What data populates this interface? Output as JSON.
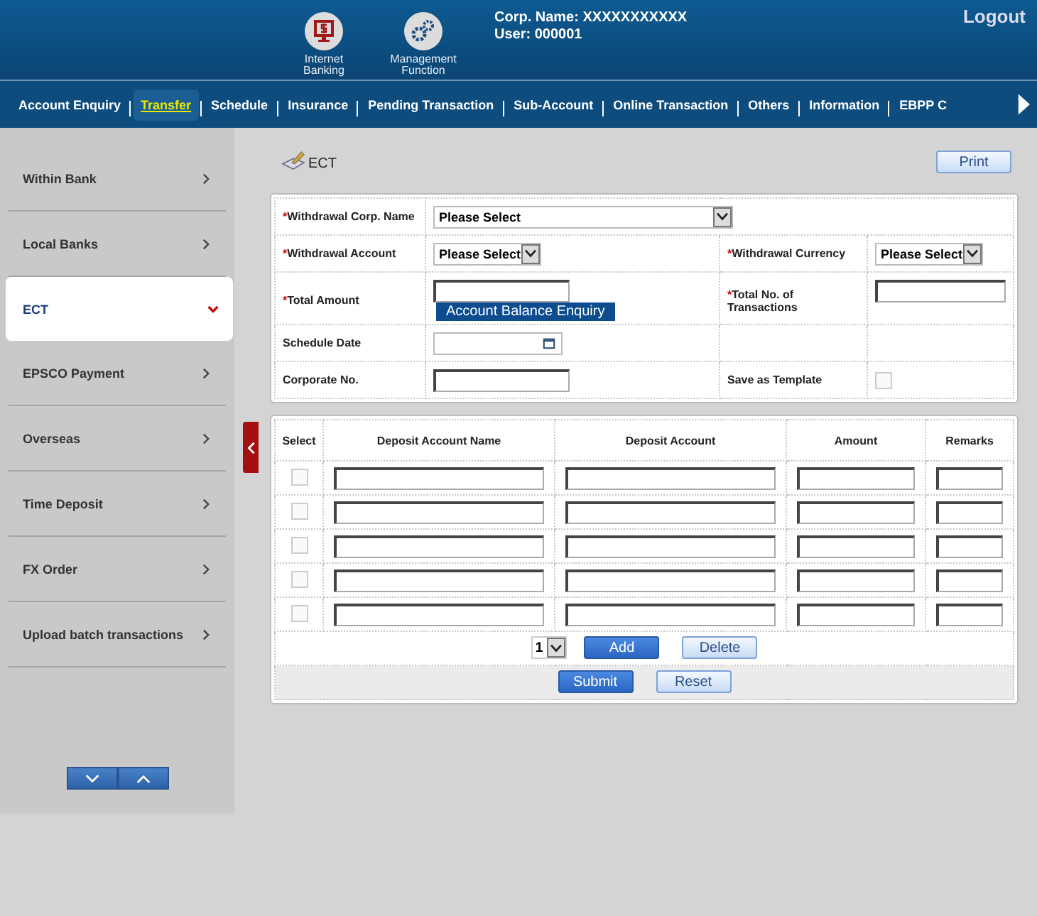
{
  "header": {
    "apps": [
      {
        "kind": "banking",
        "label": "Internet Banking"
      },
      {
        "kind": "management",
        "label": "Management Function"
      }
    ],
    "corp_name": "Corp. Name: XXXXXXXXXXX",
    "user": "User: 000001",
    "logout": "Logout"
  },
  "nav": {
    "items": [
      {
        "label": "Account Enquiry",
        "selected": false
      },
      {
        "label": "Transfer",
        "selected": true
      },
      {
        "label": "Schedule",
        "selected": false
      },
      {
        "label": "Insurance",
        "selected": false
      },
      {
        "label": "Pending Transaction",
        "selected": false
      },
      {
        "label": "Sub-Account",
        "selected": false
      },
      {
        "label": "Online Transaction",
        "selected": false
      },
      {
        "label": "Others",
        "selected": false
      },
      {
        "label": "Information",
        "selected": false
      },
      {
        "label": "EBPP C",
        "selected": false
      }
    ]
  },
  "sidebar": {
    "items": [
      {
        "label": "Within Bank",
        "selected": false
      },
      {
        "label": "Local Banks",
        "selected": false
      },
      {
        "label": "ECT",
        "selected": true
      },
      {
        "label": "EPSCO Payment",
        "selected": false
      },
      {
        "label": "Overseas",
        "selected": false
      },
      {
        "label": "Time Deposit",
        "selected": false
      },
      {
        "label": "FX Order",
        "selected": false
      },
      {
        "label": "Upload batch transactions",
        "selected": false
      }
    ]
  },
  "page": {
    "title": "ECT",
    "print": "Print"
  },
  "form": {
    "corp_name": {
      "required_mark": "*",
      "label": "Withdrawal Corp. Name",
      "value": "Please Select"
    },
    "account": {
      "required_mark": "*",
      "label": "Withdrawal Account",
      "value": "Please Select"
    },
    "currency": {
      "required_mark": "*",
      "label": "Withdrawal Currency",
      "value": "Please Select"
    },
    "total_amount": {
      "required_mark": "*",
      "label": "Total Amount",
      "link": "Account Balance Enquiry"
    },
    "total_no": {
      "required_mark": "*",
      "label": "Total No. of Transactions"
    },
    "schedule_date": {
      "label": "Schedule Date"
    },
    "corporate_no": {
      "label": "Corporate No."
    },
    "save_template": {
      "label": "Save as Template",
      "checked": false
    }
  },
  "deposits": {
    "columns": [
      "Select",
      "Deposit Account Name",
      "Deposit Account",
      "Amount",
      "Remarks"
    ],
    "rows": [
      {
        "checked": false
      },
      {
        "checked": false
      },
      {
        "checked": false
      },
      {
        "checked": false
      },
      {
        "checked": false
      }
    ],
    "count": "1",
    "buttons": [
      {
        "label": "Add",
        "kind": "primary"
      },
      {
        "label": "Delete",
        "kind": "secondary"
      }
    ],
    "actions": [
      {
        "label": "Submit",
        "kind": "primary"
      },
      {
        "label": "Reset",
        "kind": "secondary"
      }
    ]
  }
}
